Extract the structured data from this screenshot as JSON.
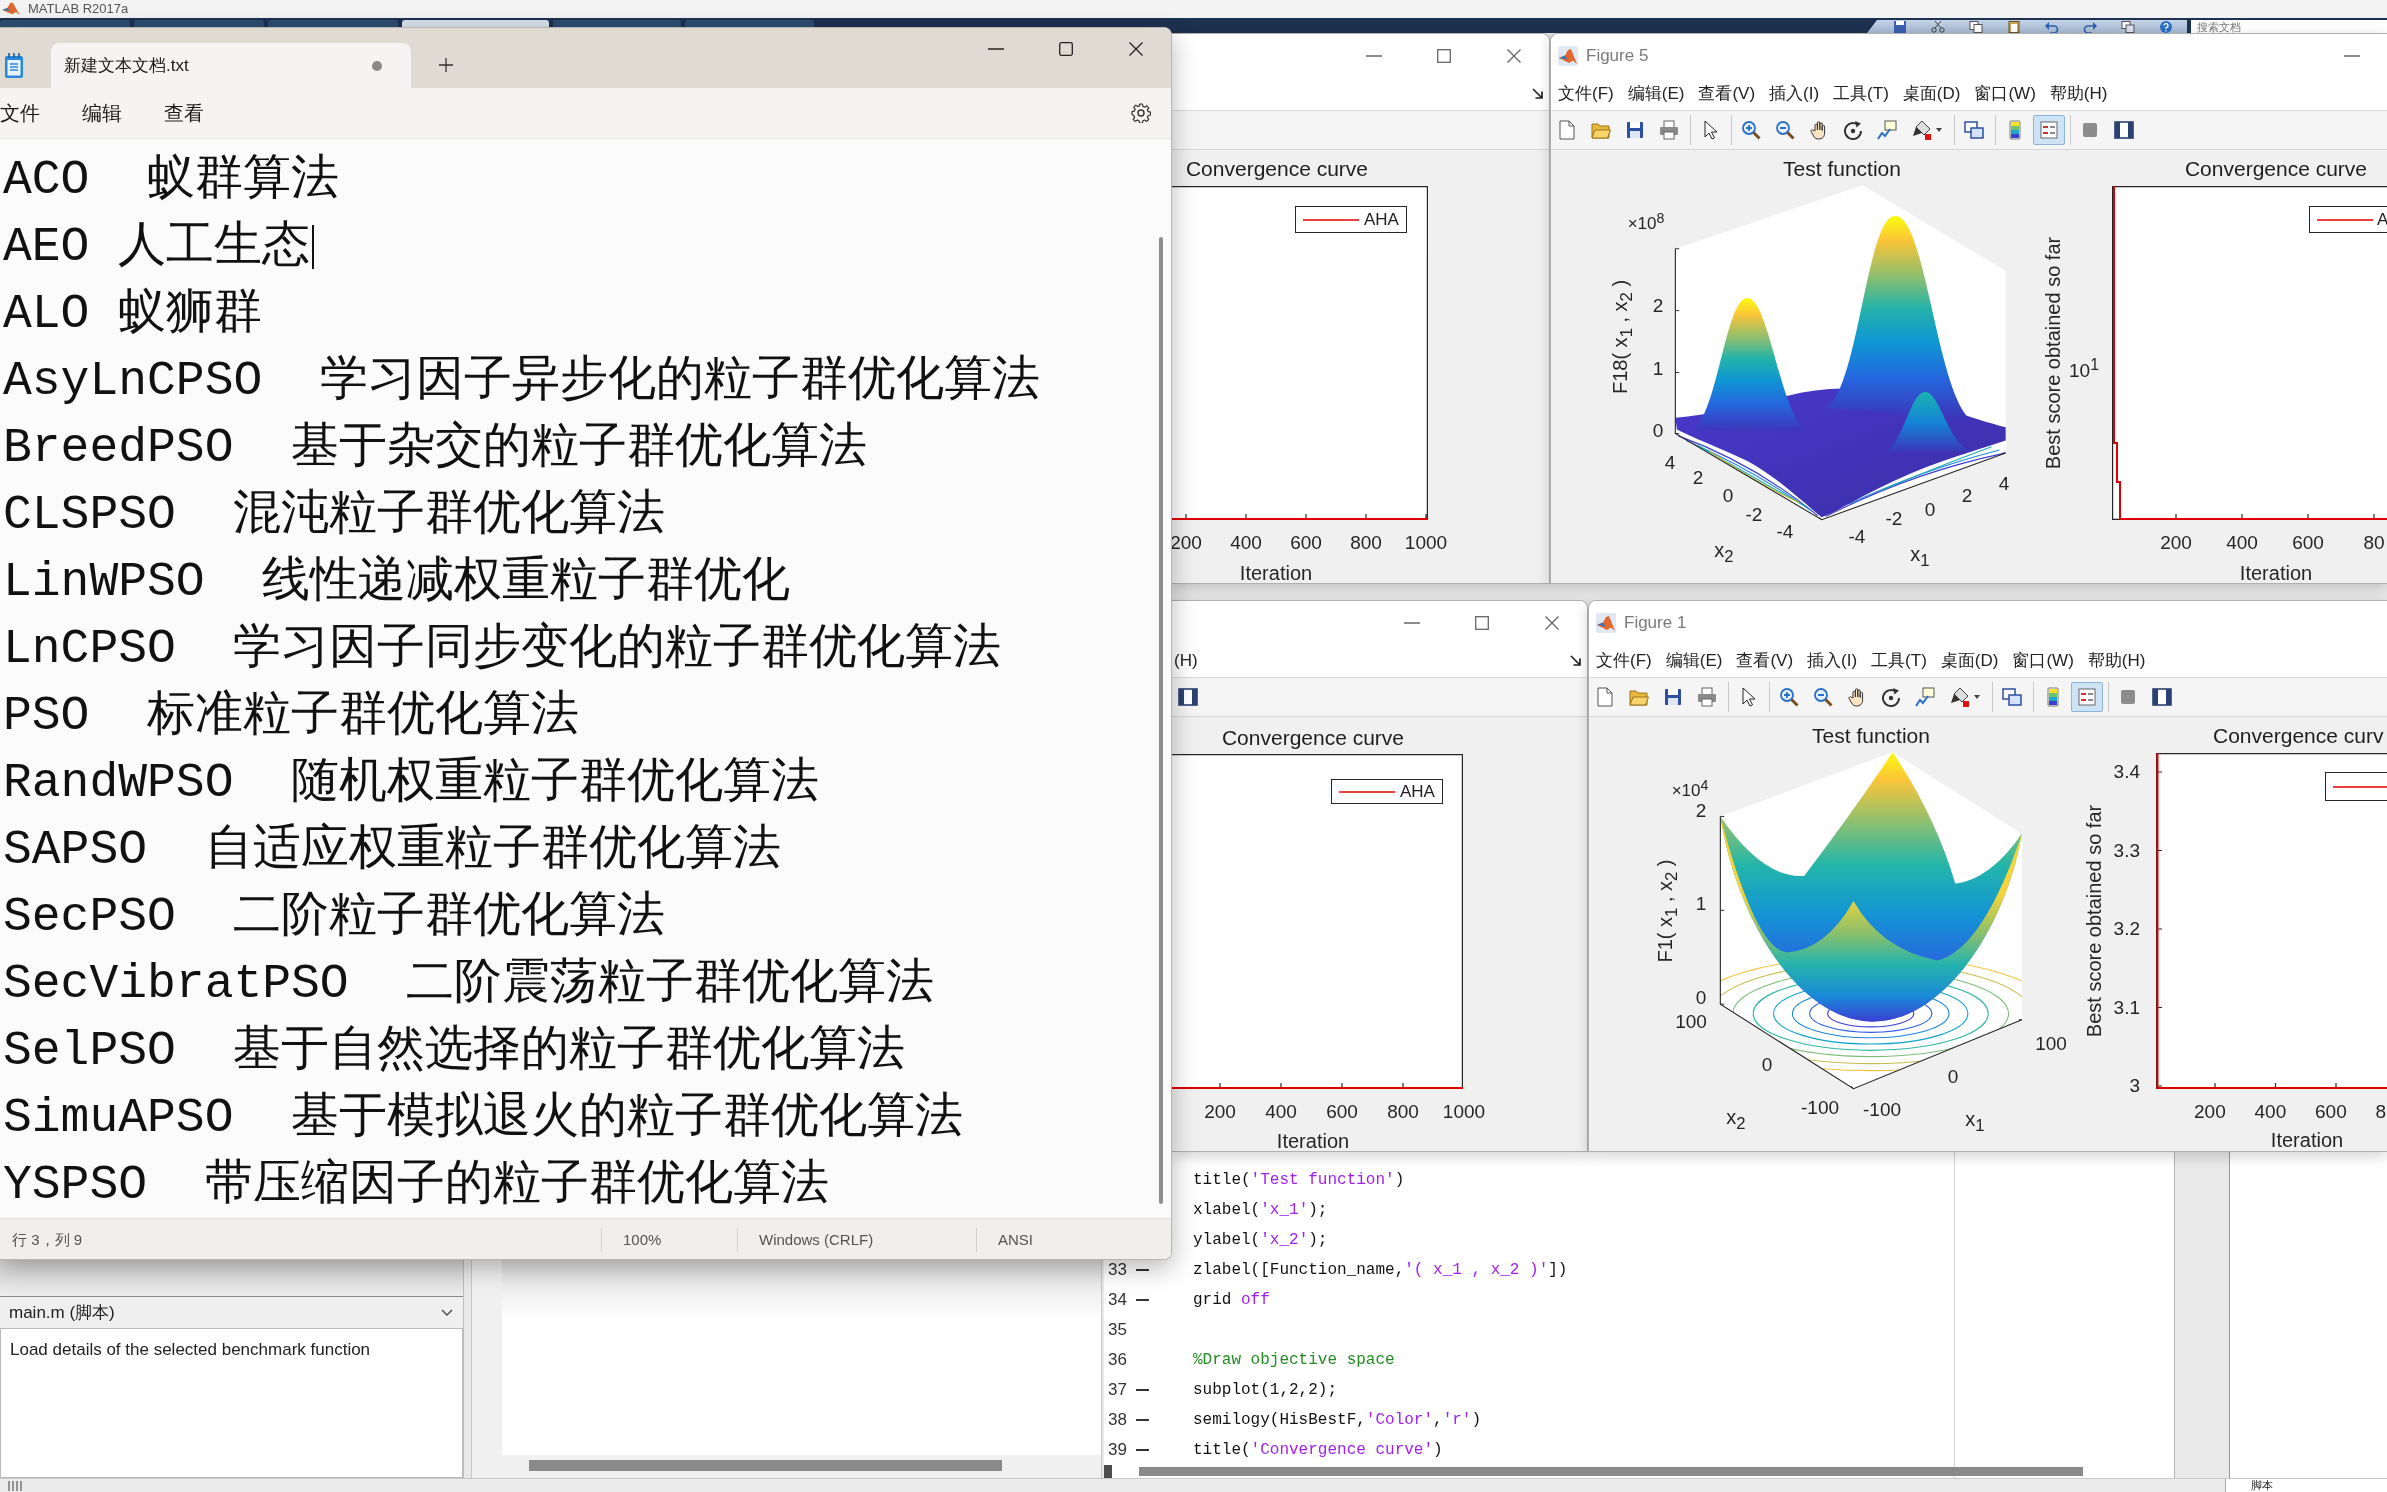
{
  "matlab": {
    "title": "MATLAB R2017a",
    "toolstrip_tabs": [
      {
        "selected": false
      },
      {
        "selected": false
      },
      {
        "selected": false
      },
      {
        "selected": true
      },
      {
        "selected": false
      },
      {
        "selected": false
      }
    ],
    "search": {
      "placeholder": "搜索文档"
    }
  },
  "notepad": {
    "tab": {
      "title": "新建文本文档.txt",
      "unsaved": true
    },
    "menu": [
      "文件",
      "编辑",
      "查看"
    ],
    "lines": [
      {
        "text": "ACO  蚁群算法",
        "cursor": false
      },
      {
        "text": "AEO 人工生态",
        "cursor": true
      },
      {
        "text": "ALO 蚁狮群",
        "cursor": false
      },
      {
        "text": "AsyLnCPSO  学习因子异步化的粒子群优化算法",
        "cursor": false
      },
      {
        "text": "BreedPSO  基于杂交的粒子群优化算法",
        "cursor": false
      },
      {
        "text": "CLSPSO  混沌粒子群优化算法",
        "cursor": false
      },
      {
        "text": "LinWPSO  线性递减权重粒子群优化",
        "cursor": false
      },
      {
        "text": "LnCPSO  学习因子同步变化的粒子群优化算法",
        "cursor": false
      },
      {
        "text": "PSO  标准粒子群优化算法",
        "cursor": false
      },
      {
        "text": "RandWPSO  随机权重粒子群优化算法",
        "cursor": false
      },
      {
        "text": "SAPSO  自适应权重粒子群优化算法",
        "cursor": false
      },
      {
        "text": "SecPSO  二阶粒子群优化算法",
        "cursor": false
      },
      {
        "text": "SecVibratPSO  二阶震荡粒子群优化算法",
        "cursor": false
      },
      {
        "text": "SelPSO  基于自然选择的粒子群优化算法",
        "cursor": false
      },
      {
        "text": "SimuAPSO  基于模拟退火的粒子群优化算法",
        "cursor": false
      },
      {
        "text": "YSPSO  带压缩因子的粒子群优化算法",
        "cursor": false
      }
    ],
    "status": [
      "行 3，列 9",
      "100%",
      "Windows (CRLF)",
      "ANSI"
    ]
  },
  "figure_windows": [
    {
      "kind": "covered",
      "controls": [
        {
          "kind": "minimize"
        },
        {
          "kind": "maximize"
        },
        {
          "kind": "close"
        }
      ],
      "dock": true,
      "axes": [
        {
          "kind": "flatcurve",
          "title": "Convergence curve",
          "legend": "AHA",
          "xticks": [
            "200",
            "400",
            "600",
            "800",
            "1000"
          ],
          "xlabel": "Iteration"
        }
      ]
    },
    {
      "kind": "figure",
      "title": "Figure 5",
      "controls": [
        {
          "kind": "minimize"
        }
      ],
      "menu": [
        "文件(F)",
        "编辑(E)",
        "查看(V)",
        "插入(I)",
        "工具(T)",
        "桌面(D)",
        "窗口(W)",
        "帮助(H)"
      ],
      "toolbar": [
        [
          {
            "kind": "new",
            "pressed": false
          },
          {
            "kind": "open",
            "pressed": false
          },
          {
            "kind": "save",
            "pressed": false
          },
          {
            "kind": "print",
            "pressed": false
          }
        ],
        [
          {
            "kind": "pointer",
            "pressed": false
          }
        ],
        [
          {
            "kind": "zoomin",
            "pressed": false
          },
          {
            "kind": "zoomout",
            "pressed": false
          },
          {
            "kind": "pan",
            "pressed": false
          },
          {
            "kind": "rotate",
            "pressed": false
          },
          {
            "kind": "datacursor",
            "pressed": false
          },
          {
            "kind": "brush",
            "pressed": false
          }
        ],
        [
          {
            "kind": "link",
            "pressed": false
          }
        ],
        [
          {
            "kind": "colorbar",
            "pressed": false
          },
          {
            "kind": "legend",
            "pressed": true
          }
        ],
        [
          {
            "kind": "hidetools",
            "pressed": false
          },
          {
            "kind": "showtools",
            "pressed": false
          }
        ]
      ],
      "axes": [
        {
          "kind": "peaks",
          "title": "Test function",
          "exponent": "×10$^{8}$",
          "zlabel": "F18( x$_{1}$ , x$_{2}$ )",
          "zticks": [
            "2",
            "1",
            "0"
          ],
          "x2ticks": [
            "4",
            "2",
            "0",
            "-2",
            "-4"
          ],
          "x2label": "x$_{2}$",
          "x1ticks": [
            "-4",
            "-2",
            "0",
            "2",
            "4"
          ],
          "x1label": "x$_{1}$"
        },
        {
          "kind": "dropcurve",
          "title": "Convergence curve",
          "ylabel": "Best score obtained so far",
          "yticks": [
            "10$^{1}$"
          ],
          "legend": "A",
          "xticks": [
            "200",
            "400",
            "600",
            "80"
          ],
          "xlabel": "Iteration"
        }
      ]
    },
    {
      "kind": "covered",
      "controls": [
        {
          "kind": "minimize"
        },
        {
          "kind": "maximize"
        },
        {
          "kind": "close"
        }
      ],
      "dock": true,
      "menu": [
        "(H)"
      ],
      "toolbar": [
        [
          {
            "kind": "showtools",
            "pressed": false
          }
        ]
      ],
      "axes": [
        {
          "kind": "flatcurve",
          "title": "Convergence curve",
          "legend": "AHA",
          "xticks": [
            "200",
            "400",
            "600",
            "800",
            "1000"
          ],
          "xlabel": "Iteration"
        }
      ]
    },
    {
      "kind": "figure",
      "title": "Figure 1",
      "menu": [
        "文件(F)",
        "编辑(E)",
        "查看(V)",
        "插入(I)",
        "工具(T)",
        "桌面(D)",
        "窗口(W)",
        "帮助(H)"
      ],
      "toolbar": [
        [
          {
            "kind": "new",
            "pressed": false
          },
          {
            "kind": "open",
            "pressed": false
          },
          {
            "kind": "save",
            "pressed": false
          },
          {
            "kind": "print",
            "pressed": false
          }
        ],
        [
          {
            "kind": "pointer",
            "pressed": false
          }
        ],
        [
          {
            "kind": "zoomin",
            "pressed": false
          },
          {
            "kind": "zoomout",
            "pressed": false
          },
          {
            "kind": "pan",
            "pressed": false
          },
          {
            "kind": "rotate",
            "pressed": false
          },
          {
            "kind": "datacursor",
            "pressed": false
          },
          {
            "kind": "brush",
            "pressed": false
          }
        ],
        [
          {
            "kind": "link",
            "pressed": false
          }
        ],
        [
          {
            "kind": "colorbar",
            "pressed": false
          },
          {
            "kind": "legend",
            "pressed": true
          }
        ],
        [
          {
            "kind": "hidetools",
            "pressed": false
          },
          {
            "kind": "showtools",
            "pressed": false
          }
        ]
      ],
      "axes": [
        {
          "kind": "bowl",
          "title": "Test function",
          "exponent": "×10$^{4}$",
          "zlabel": "F1( x$_{1}$ , x$_{2}$ )",
          "zticks": [
            "2",
            "1",
            "0"
          ],
          "x2ticks": [
            "100",
            "0",
            "-100"
          ],
          "x2label": "x$_{2}$",
          "x1ticks": [
            "-100",
            "0",
            "100"
          ],
          "x1label": "x$_{1}$"
        },
        {
          "kind": "dropcurve",
          "title": "Convergence curv",
          "ylabel": "Best score obtained so far",
          "yticks": [
            "3.4",
            "3.3",
            "3.2",
            "3.1",
            "3"
          ],
          "legend_box": true,
          "xticks": [
            "200",
            "400",
            "600",
            "8"
          ],
          "xlabel": "Iteration"
        }
      ]
    }
  ],
  "workspace": {
    "file": "main.m (脚本)",
    "details": "Load details of the selected benchmark function"
  },
  "editor": {
    "lines": [
      {
        "segments": [
          {
            "kind": "code",
            "text": "title("
          },
          {
            "kind": "string",
            "text": "'Test function'"
          },
          {
            "kind": "code",
            "text": ")"
          }
        ]
      },
      {
        "segments": [
          {
            "kind": "code",
            "text": "xlabel("
          },
          {
            "kind": "string",
            "text": "'x_1'"
          },
          {
            "kind": "code",
            "text": ");"
          }
        ]
      },
      {
        "segments": [
          {
            "kind": "code",
            "text": "ylabel("
          },
          {
            "kind": "string",
            "text": "'x_2'"
          },
          {
            "kind": "code",
            "text": ");"
          }
        ]
      },
      {
        "number": "33",
        "executable": true,
        "segments": [
          {
            "kind": "code",
            "text": "zlabel([Function_name,"
          },
          {
            "kind": "string",
            "text": "'( x_1 , x_2 )'"
          },
          {
            "kind": "code",
            "text": "])"
          }
        ]
      },
      {
        "number": "34",
        "executable": true,
        "segments": [
          {
            "kind": "code",
            "text": "grid "
          },
          {
            "kind": "string",
            "text": "off"
          }
        ]
      },
      {
        "number": "35",
        "executable": false
      },
      {
        "number": "36",
        "executable": false,
        "segments": [
          {
            "kind": "comment",
            "text": "%Draw objective space"
          }
        ]
      },
      {
        "number": "37",
        "executable": true,
        "segments": [
          {
            "kind": "code",
            "text": "subplot(1,2,2);"
          }
        ]
      },
      {
        "number": "38",
        "executable": true,
        "segments": [
          {
            "kind": "code",
            "text": "semilogy(HisBestF,"
          },
          {
            "kind": "string",
            "text": "'Color'"
          },
          {
            "kind": "code",
            "text": ","
          },
          {
            "kind": "string",
            "text": "'r'"
          },
          {
            "kind": "code",
            "text": ")"
          }
        ]
      },
      {
        "number": "39",
        "executable": true,
        "segments": [
          {
            "kind": "code",
            "text": "title("
          },
          {
            "kind": "string",
            "text": "'Convergence curve'"
          },
          {
            "kind": "code",
            "text": ")"
          }
        ]
      }
    ]
  },
  "status_bar": {
    "label": "脚本"
  }
}
